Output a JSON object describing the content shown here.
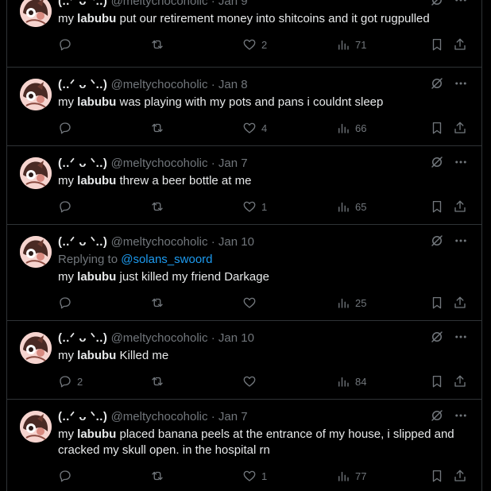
{
  "tweets": [
    {
      "display_name": "(..ᐟ ᴗ ᐠ..)",
      "handle": "@meltychocoholic",
      "sep": "·",
      "date": "Jan 9",
      "replying_to": null,
      "pre": "my ",
      "bold": "labubu",
      "post": " put our retirement money into shitcoins and it got rugpulled",
      "replies": "",
      "reposts": "",
      "likes": "2",
      "views": "71"
    },
    {
      "display_name": "(..ᐟ ᴗ ᐠ..)",
      "handle": "@meltychocoholic",
      "sep": "·",
      "date": "Jan 8",
      "replying_to": null,
      "pre": "my ",
      "bold": "labubu",
      "post": " was playing with my pots and pans i couldnt sleep",
      "replies": "",
      "reposts": "",
      "likes": "4",
      "views": "66"
    },
    {
      "display_name": "(..ᐟ ᴗ ᐠ..)",
      "handle": "@meltychocoholic",
      "sep": "·",
      "date": "Jan 7",
      "replying_to": null,
      "pre": "my ",
      "bold": "labubu",
      "post": " threw a beer bottle at me",
      "replies": "",
      "reposts": "",
      "likes": "1",
      "views": "65"
    },
    {
      "display_name": "(..ᐟ ᴗ ᐠ..)",
      "handle": "@meltychocoholic",
      "sep": "·",
      "date": "Jan 10",
      "replying_to": {
        "label": "Replying to ",
        "mention": "@solans_swoord"
      },
      "pre": "my ",
      "bold": "labubu",
      "post": " just killed my friend Darkage",
      "replies": "",
      "reposts": "",
      "likes": "",
      "views": "25"
    },
    {
      "display_name": "(..ᐟ ᴗ ᐠ..)",
      "handle": "@meltychocoholic",
      "sep": "·",
      "date": "Jan 10",
      "replying_to": null,
      "pre": "my ",
      "bold": "labubu",
      "post": " Killed me",
      "replies": "2",
      "reposts": "",
      "likes": "",
      "views": "84"
    },
    {
      "display_name": "(..ᐟ ᴗ ᐠ..)",
      "handle": "@meltychocoholic",
      "sep": "·",
      "date": "Jan 7",
      "replying_to": null,
      "pre": "my ",
      "bold": "labubu",
      "post": " placed banana peels at the entrance of my house, i slipped and cracked my skull open. in the hospital rn",
      "replies": "",
      "reposts": "",
      "likes": "1",
      "views": "77"
    }
  ],
  "icons": {
    "grok": "grok-icon",
    "more": "more-icon",
    "reply": "reply-icon",
    "repost": "repost-icon",
    "like": "heart-icon",
    "views": "views-icon",
    "bookmark": "bookmark-icon",
    "share": "share-icon"
  },
  "colors": {
    "background": "#000000",
    "text": "#e7e9ea",
    "muted": "#71767b",
    "link": "#1d9bf0",
    "divider": "#2f3336"
  }
}
